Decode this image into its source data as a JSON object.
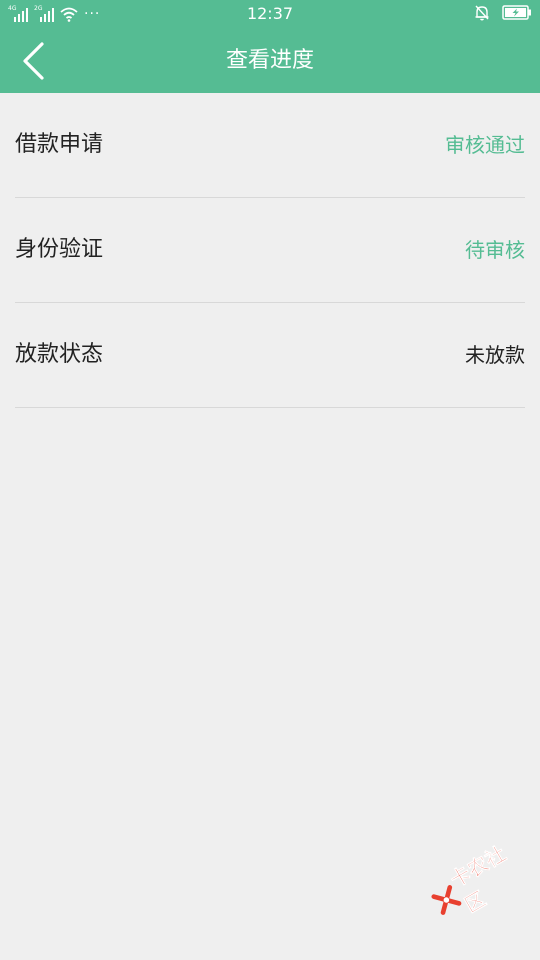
{
  "status_bar": {
    "sim1_tag": "4G",
    "sim2_tag": "2G",
    "more_dots": "···",
    "time": "12:37"
  },
  "header": {
    "title": "查看进度"
  },
  "rows": [
    {
      "label": "借款申请",
      "value": "审核通过"
    },
    {
      "label": "身份验证",
      "value": "待审核"
    },
    {
      "label": "放款状态",
      "value": "未放款"
    }
  ],
  "watermark": {
    "text": "卡农社区"
  },
  "colors": {
    "header_bg": "#55bc93",
    "page_bg": "#efefef",
    "status_green": "#55bc93",
    "text_dark": "#222222",
    "watermark_red": "#e8402f"
  }
}
